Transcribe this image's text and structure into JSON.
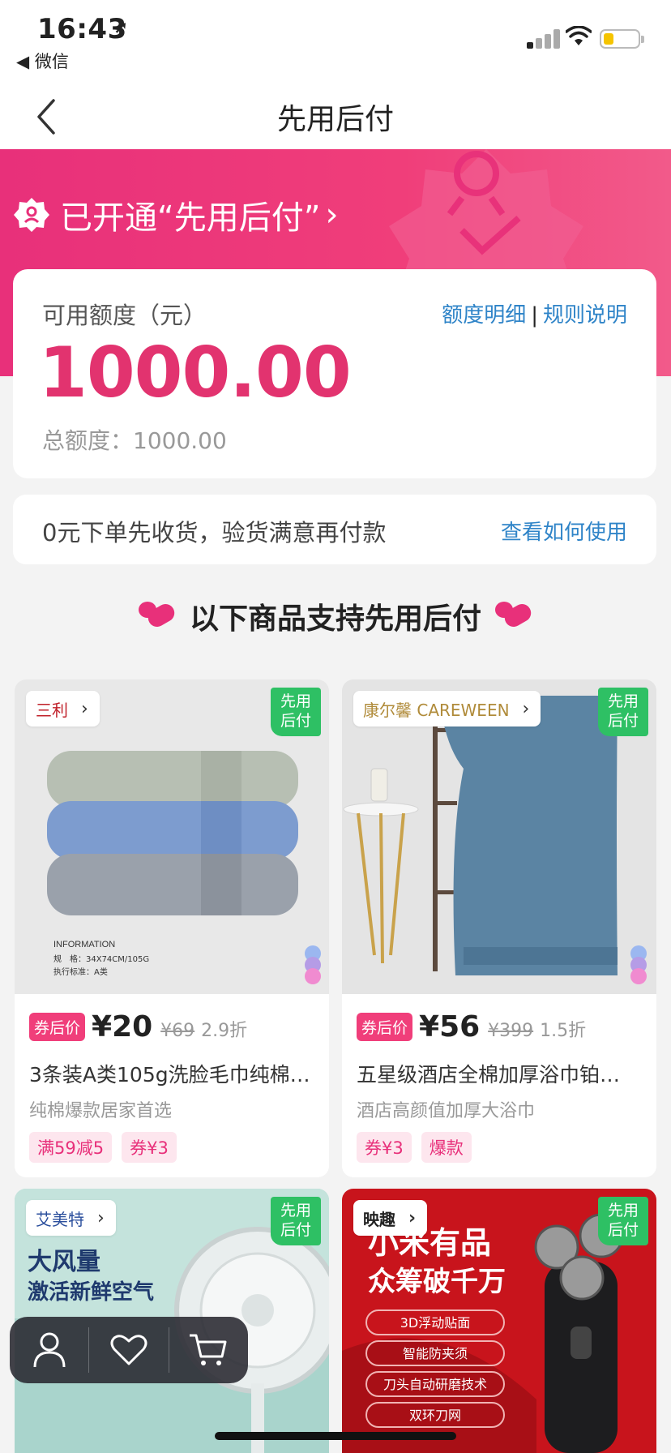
{
  "status_bar": {
    "time": "16:43",
    "location_icon": "location-arrow-icon",
    "back_app": "◀ 微信"
  },
  "nav": {
    "title": "先用后付"
  },
  "banner": {
    "title": "已开通“先用后付”",
    "arrow": "›"
  },
  "credit": {
    "label": "可用额度（元）",
    "amount": "1000.00",
    "total": "总额度：1000.00",
    "link_detail": "额度明细",
    "link_sep": "|",
    "link_rules": "规则说明"
  },
  "info": {
    "text": "0元下单先收货，验货满意再付款",
    "link": "查看如何使用"
  },
  "section": {
    "title": "以下商品支持先用后付"
  },
  "products": [
    {
      "brand": "三利",
      "flag_line1": "先用",
      "flag_line2": "后付",
      "image_text_1": "INFORMATION",
      "image_text_2": "规　格：34X74CM/105G",
      "image_text_3": "执行标准：A类",
      "coupon_label": "券后价",
      "price": "¥20",
      "original": "¥69",
      "discount": "2.9折",
      "title": "3条装A类105g洗脸毛巾纯棉…",
      "subtitle": "纯棉爆款居家首选",
      "tags": [
        "满59减5",
        "券¥3"
      ]
    },
    {
      "brand": "康尔馨 CAREWEEN",
      "flag_line1": "先用",
      "flag_line2": "后付",
      "coupon_label": "券后价",
      "price": "¥56",
      "original": "¥399",
      "discount": "1.5折",
      "title": "五星级酒店全棉加厚浴巾铂…",
      "subtitle": "酒店高颜值加厚大浴巾",
      "tags": [
        "券¥3",
        "爆款"
      ]
    },
    {
      "brand": "艾美特",
      "flag_line1": "先用",
      "flag_line2": "后付",
      "image_text_1": "大风量",
      "image_text_2": "激活新鲜空气"
    },
    {
      "brand": "映趣",
      "flag_line1": "先用",
      "flag_line2": "后付",
      "image_text_1": "小米有品",
      "image_text_2": "众筹破千万",
      "features": [
        "3D浮动贴面",
        "智能防夹须",
        "刀头自动研磨技术",
        "双环刀网"
      ]
    }
  ],
  "colors": {
    "accent": "#e8307a",
    "link": "#2f84c8",
    "flag": "#2ec064",
    "price": "#e2336f"
  }
}
